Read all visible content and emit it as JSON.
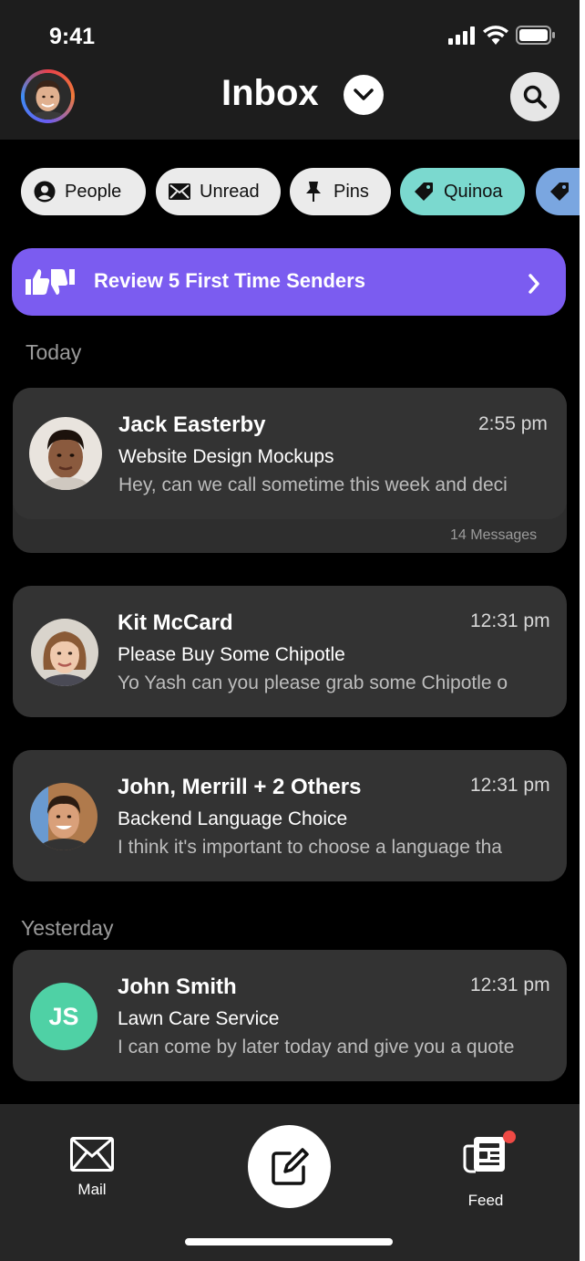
{
  "status": {
    "time": "9:41"
  },
  "header": {
    "title": "Inbox"
  },
  "filters": [
    {
      "label": "People",
      "icon": "person-icon"
    },
    {
      "label": "Unread",
      "icon": "envelope-icon"
    },
    {
      "label": "Pins",
      "icon": "pin-icon"
    },
    {
      "label": "Quinoa",
      "icon": "tag-icon"
    },
    {
      "label": "",
      "icon": "tag-icon"
    }
  ],
  "review": {
    "label": "Review 5 First Time Senders"
  },
  "sections": {
    "today": "Today",
    "yesterday": "Yesterday"
  },
  "messages": [
    {
      "sender": "Jack Easterby",
      "time": "2:55 pm",
      "subject": "Website Design Mockups",
      "preview": "Hey, can we call sometime this week and deci",
      "count": "14 Messages"
    },
    {
      "sender": "Kit McCard",
      "time": "12:31 pm",
      "subject": "Please Buy Some Chipotle",
      "preview": "Yo Yash can you please grab some Chipotle o"
    },
    {
      "sender": "John, Merrill + 2 Others",
      "time": "12:31 pm",
      "subject": "Backend Language Choice",
      "preview": "I think it's important to choose a language tha"
    },
    {
      "sender": "John Smith",
      "initials": "JS",
      "time": "12:31 pm",
      "subject": "Lawn Care Service",
      "preview": "I can come by later today and give you a quote"
    }
  ],
  "tabbar": {
    "mail": "Mail",
    "feed": "Feed"
  },
  "colors": {
    "accent_purple": "#7b5cf0",
    "chip_quinoa": "#7bd9cf",
    "chip_blue": "#7aa6e0",
    "initials_green": "#4fd1a5",
    "notification_red": "#ef4a45"
  }
}
